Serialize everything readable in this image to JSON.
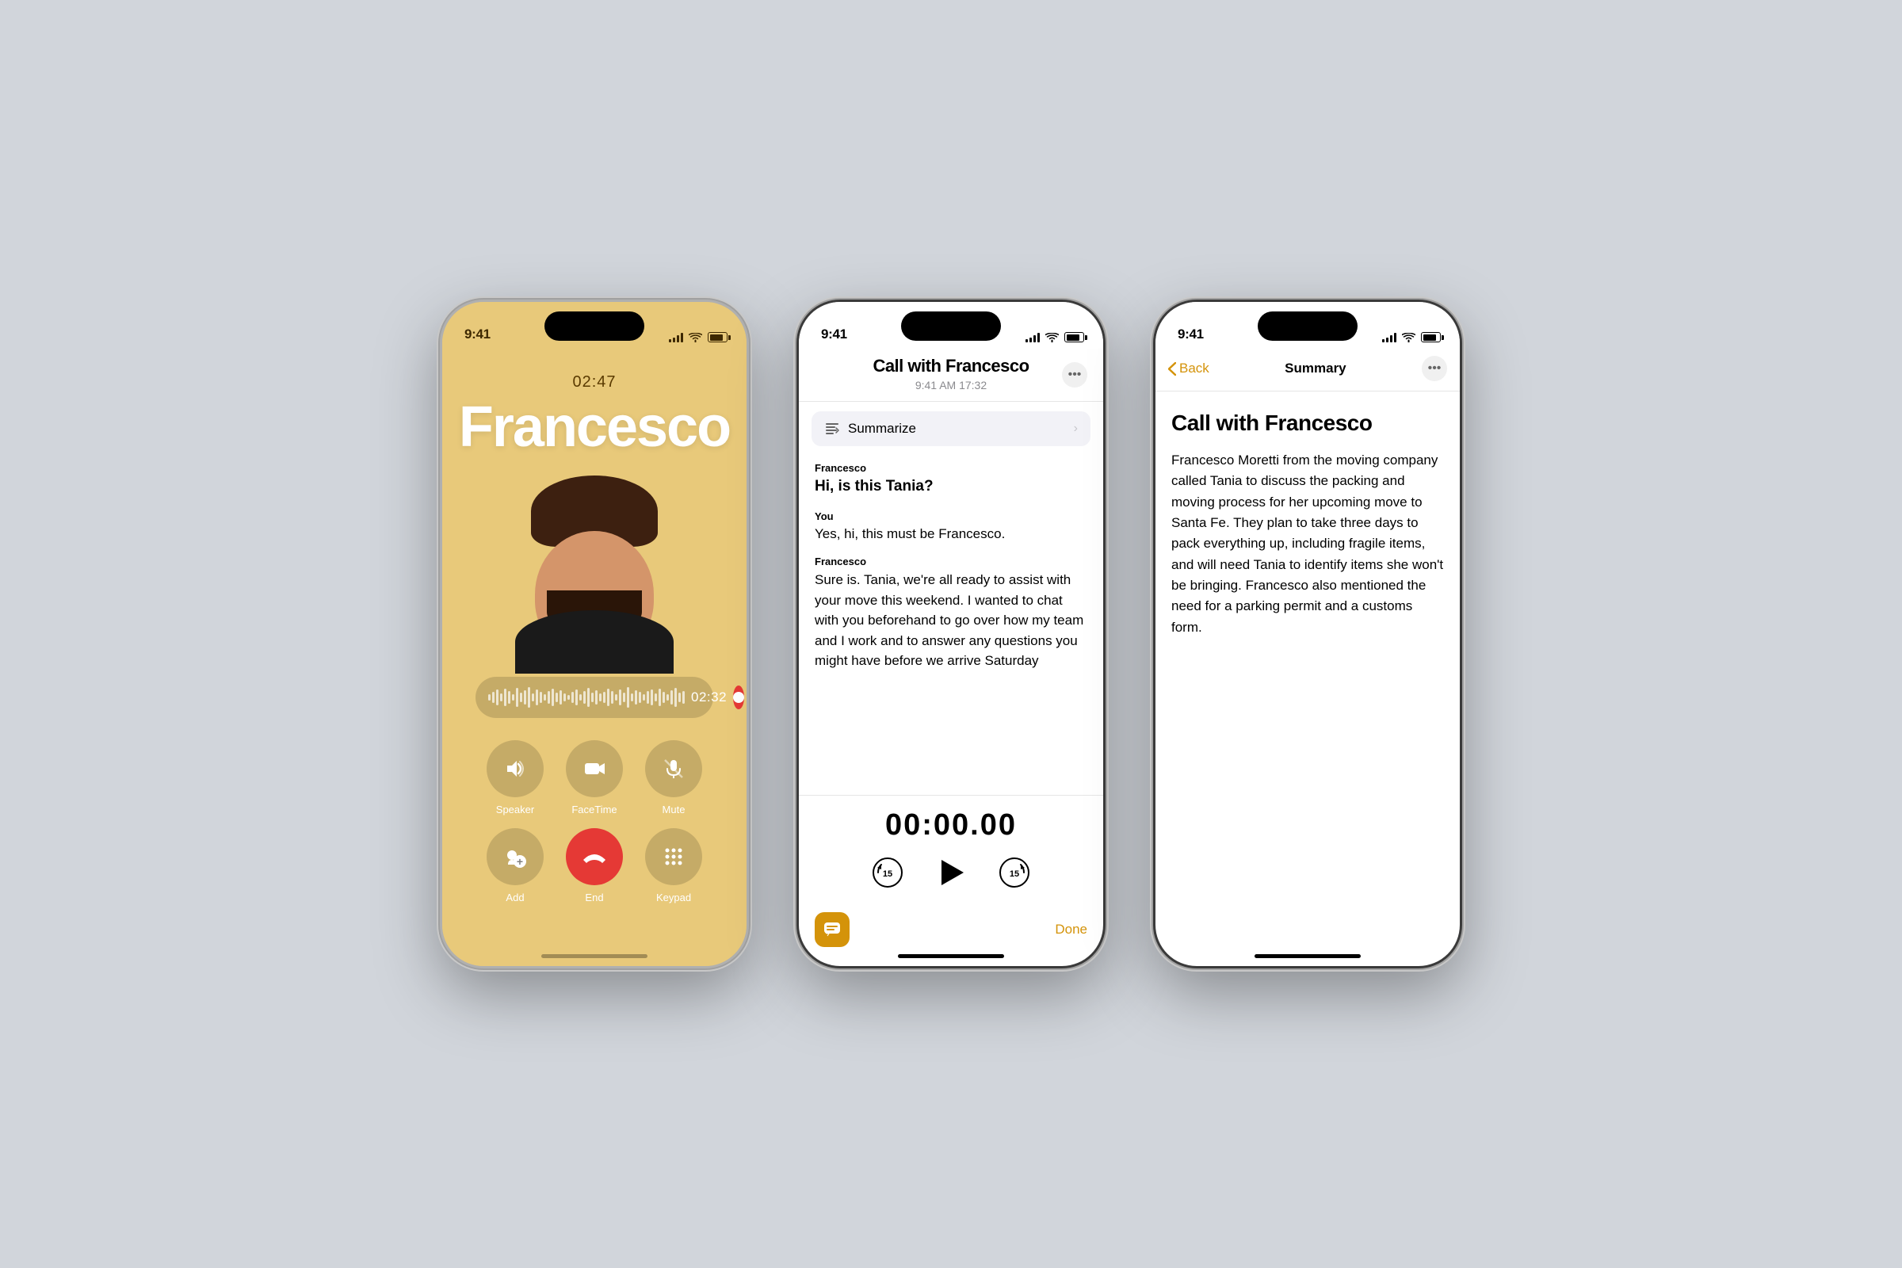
{
  "phone1": {
    "status_time": "9:41",
    "call_timer": "02:47",
    "contact_name": "Francesco",
    "waveform_time": "02:32",
    "buttons": [
      {
        "label": "Speaker",
        "icon": "speaker-icon"
      },
      {
        "label": "FaceTime",
        "icon": "facetime-icon"
      },
      {
        "label": "Mute",
        "icon": "mute-icon"
      },
      {
        "label": "Add",
        "icon": "add-icon"
      },
      {
        "label": "End",
        "icon": "end-call-icon"
      },
      {
        "label": "Keypad",
        "icon": "keypad-icon"
      }
    ]
  },
  "phone2": {
    "status_time": "9:41",
    "title": "Call with Francesco",
    "subtitle": "9:41 AM  17:32",
    "summarize_label": "Summarize",
    "messages": [
      {
        "speaker": "Francesco",
        "text": "Hi, is this Tania?",
        "bold": true
      },
      {
        "speaker": "You",
        "text": "Yes, hi, this must be Francesco.",
        "bold": false
      },
      {
        "speaker": "Francesco",
        "text": "Sure is. Tania, we're all ready to assist with your move this weekend. I wanted to chat with you beforehand to go over how my team and I work and to answer any questions you might have before we arrive Saturday",
        "bold": false
      }
    ],
    "playback_timer": "00:00.00",
    "done_label": "Done"
  },
  "phone3": {
    "status_time": "9:41",
    "back_label": "Back",
    "nav_title": "Summary",
    "title": "Call with Francesco",
    "summary_text": "Francesco Moretti from the moving company called Tania to discuss the packing and moving process for her upcoming move to Santa Fe. They plan to take three days to pack everything up, including fragile items, and will need Tania to identify items she won't be bringing. Francesco also mentioned the need for a parking permit and a customs form."
  }
}
